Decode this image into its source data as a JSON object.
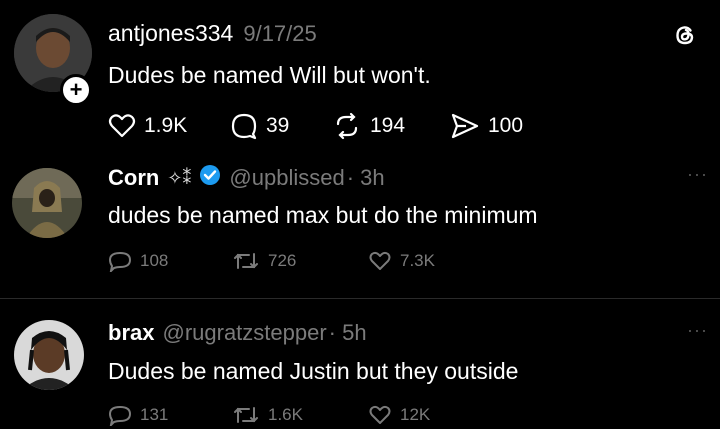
{
  "posts": [
    {
      "username": "antjones334",
      "date": "9/17/25",
      "text": "Dudes be named Will but won't.",
      "actions": [
        {
          "icon": "heart-icon",
          "count": "1.9K"
        },
        {
          "icon": "comment-icon",
          "count": "39"
        },
        {
          "icon": "repost-icon",
          "count": "194"
        },
        {
          "icon": "send-icon",
          "count": "100"
        }
      ],
      "platform_icon": "threads-logo-icon"
    },
    {
      "display_name": "Corn",
      "name_suffix": "✧⁑",
      "verified": true,
      "handle": "@upblissed",
      "time": "· 3h",
      "text": "dudes be named max but do the minimum",
      "actions": [
        {
          "icon": "reply-icon",
          "count": "108"
        },
        {
          "icon": "retweet-icon",
          "count": "726"
        },
        {
          "icon": "like-icon",
          "count": "7.3K"
        }
      ],
      "more": "···"
    },
    {
      "display_name": "brax",
      "handle": "@rugratzstepper",
      "time": "· 5h",
      "text": "Dudes be named Justin but they outside",
      "actions": [
        {
          "icon": "reply-icon",
          "count": "131"
        },
        {
          "icon": "retweet-icon",
          "count": "1.6K"
        },
        {
          "icon": "like-icon",
          "count": "12K"
        }
      ],
      "more": "···"
    }
  ],
  "colors": {
    "background": "#000000",
    "text": "#ffffff",
    "muted": "#7b7b7b",
    "verified": "#1d9bf0"
  }
}
